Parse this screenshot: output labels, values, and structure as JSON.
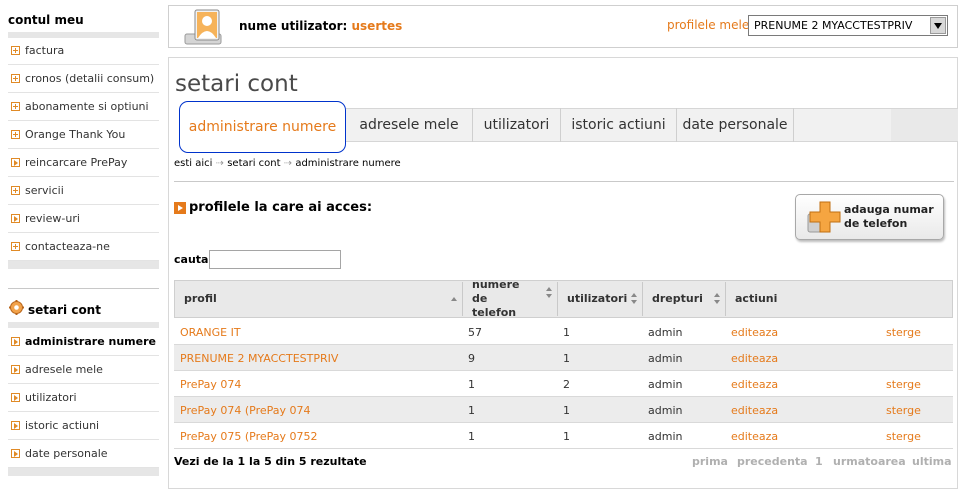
{
  "sidebar": {
    "account_title": "contul meu",
    "account_items": [
      {
        "label": "factura"
      },
      {
        "label": "cronos (detalii consum)"
      },
      {
        "label": "abonamente si optiuni"
      },
      {
        "label": "Orange Thank You"
      },
      {
        "label": "reincarcare PrePay"
      },
      {
        "label": "servicii"
      },
      {
        "label": "review-uri"
      },
      {
        "label": "contacteaza-ne"
      }
    ],
    "settings_title": "setari cont",
    "settings_items": [
      {
        "label": "administrare numere"
      },
      {
        "label": "adresele mele"
      },
      {
        "label": "utilizatori"
      },
      {
        "label": "istoric actiuni"
      },
      {
        "label": "date personale"
      }
    ]
  },
  "header": {
    "user_label": "nume utilizator:",
    "user_name": "usertes",
    "profiles_label": "profilele mele:",
    "profiles_selected": "PRENUME 2 MYACCTESTPRIV"
  },
  "main": {
    "title": "setari cont",
    "tabs": [
      {
        "label": "administrare numere"
      },
      {
        "label": "adresele mele"
      },
      {
        "label": "utilizatori"
      },
      {
        "label": "istoric actiuni"
      },
      {
        "label": "date personale"
      }
    ],
    "breadcrumb": {
      "part1": "esti aici",
      "sep": "⇢",
      "part2": "setari cont",
      "part3": "administrare numere"
    },
    "section_title": "profilele la care ai acces:",
    "add_button_label": "adauga numar de telefon",
    "search_label": "cauta",
    "search_value": ""
  },
  "table": {
    "headers": {
      "profile": "profil",
      "numbers": "numere de telefon",
      "users": "utilizatori",
      "rights": "drepturi",
      "actions": "actiuni"
    },
    "rows": [
      {
        "profile": "ORANGE IT",
        "numbers": "57",
        "users": "1",
        "rights": "admin",
        "edit": "editeaza",
        "delete": "sterge"
      },
      {
        "profile": "PRENUME 2 MYACCTESTPRIV",
        "numbers": "9",
        "users": "1",
        "rights": "admin",
        "edit": "editeaza",
        "delete": ""
      },
      {
        "profile": "PrePay 074",
        "numbers": "1",
        "users": "2",
        "rights": "admin",
        "edit": "editeaza",
        "delete": "sterge"
      },
      {
        "profile": "PrePay 074 (PrePay 074",
        "numbers": "1",
        "users": "1",
        "rights": "admin",
        "edit": "editeaza",
        "delete": "sterge"
      },
      {
        "profile": "PrePay 075 (PrePay 0752",
        "numbers": "1",
        "users": "1",
        "rights": "admin",
        "edit": "editeaza",
        "delete": "sterge"
      }
    ]
  },
  "pager": {
    "summary": "Vezi de la 1 la 5 din 5 rezultate",
    "first": "prima",
    "prev": "precedenta",
    "page": "1",
    "next": "urmatoarea",
    "last": "ultima"
  },
  "colors": {
    "accent": "#e57a1b",
    "active_tab_border": "#0033cc"
  }
}
